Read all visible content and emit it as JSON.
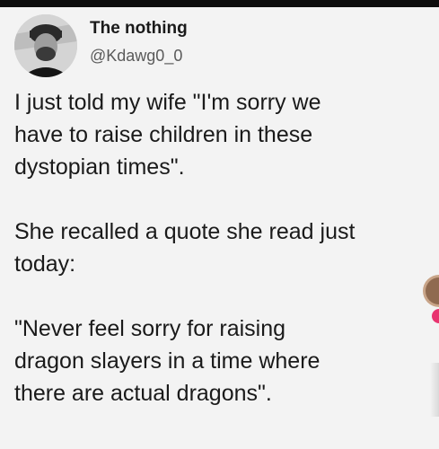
{
  "tweet": {
    "display_name": "The nothing",
    "handle": "@Kdawg0_0",
    "lines": {
      "p1_l1": "I just told my wife \"I'm sorry we",
      "p1_l2": "have to raise children in these",
      "p1_l3": "dystopian times\".",
      "p2_l1": "She recalled a quote she read just",
      "p2_l2": "today:",
      "p3_l1": "\"Never feel sorry for raising",
      "p3_l2": "dragon slayers in a time where",
      "p3_l3": "there are actual dragons\"."
    }
  },
  "colors": {
    "background": "#f3f3f3",
    "text": "#1a1a1a",
    "handle": "#5a5a5a",
    "accent_pink": "#e8336f"
  },
  "icons": {
    "avatar": "avatar-photo",
    "edge": "profile-bubble-icon"
  }
}
